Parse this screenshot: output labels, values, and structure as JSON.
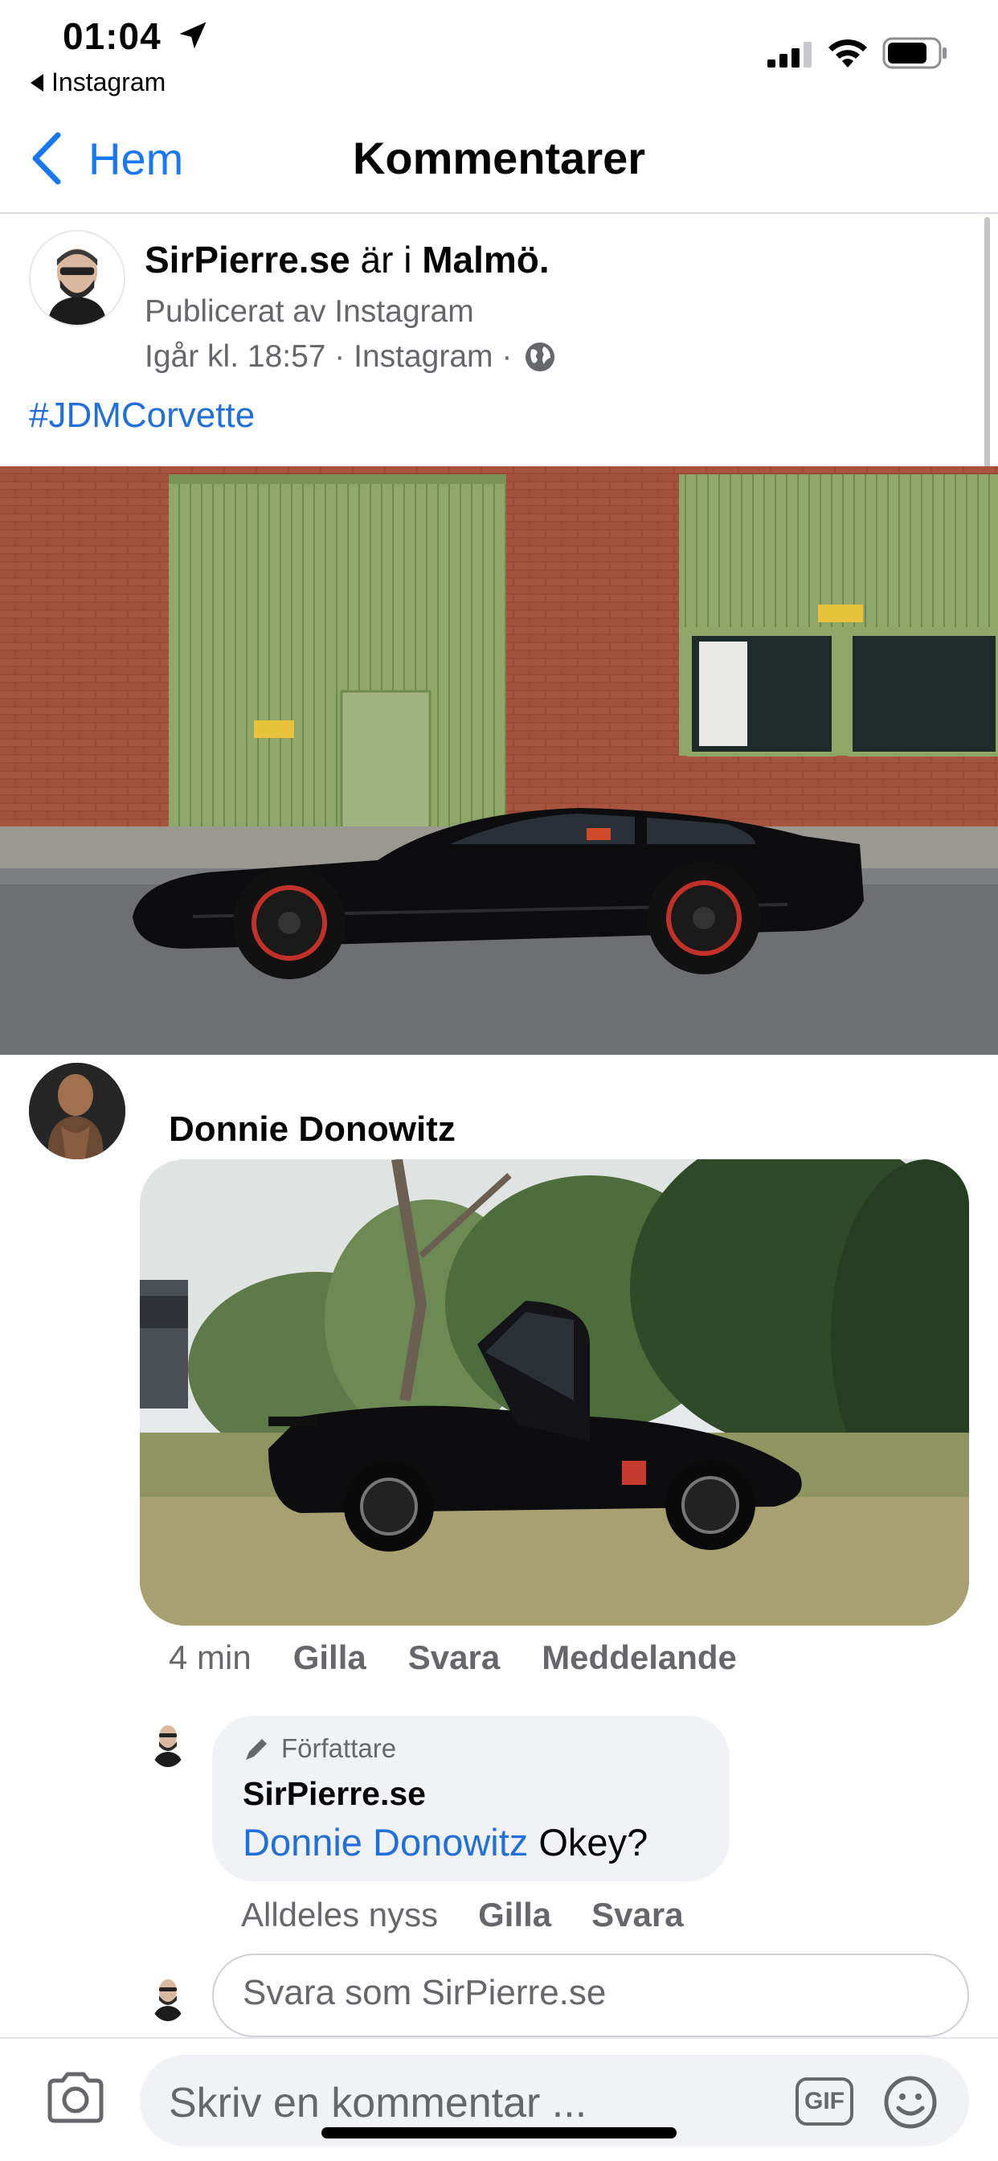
{
  "status_bar": {
    "time": "01:04",
    "back_app": "Instagram"
  },
  "nav": {
    "back_label": "Hem",
    "title": "Kommentarer"
  },
  "post": {
    "author": "SirPierre.se",
    "connector": " är i ",
    "location": "Malmö.",
    "published_by": "Publicerat av Instagram",
    "timestamp_line": "Igår kl. 18:57 · Instagram ·",
    "hashtag": "#JDMCorvette"
  },
  "comment": {
    "author": "Donnie Donowitz",
    "time": "4 min",
    "actions": [
      "Gilla",
      "Svara",
      "Meddelande"
    ]
  },
  "reply": {
    "badge": "Författare",
    "author": "SirPierre.se",
    "mention": "Donnie Donowitz",
    "text": " Okey?",
    "time": "Alldeles nyss",
    "actions": [
      "Gilla",
      "Svara"
    ]
  },
  "reply_input": {
    "placeholder": "Svara som SirPierre.se"
  },
  "composer": {
    "placeholder": "Skriv en kommentar ...",
    "gif_label": "GIF"
  },
  "icons": {
    "location_arrow": "location-arrow-icon",
    "signal": "cellular-signal-icon",
    "wifi": "wifi-icon",
    "battery": "battery-icon",
    "back": "chevron-left-icon",
    "globe": "globe-icon",
    "pencil": "pencil-icon",
    "camera": "camera-icon",
    "emoji": "smiley-icon"
  },
  "colors": {
    "accent": "#1877f2",
    "link": "#216fdb",
    "secondary_text": "#65676b",
    "bubble": "#f0f2f5"
  }
}
